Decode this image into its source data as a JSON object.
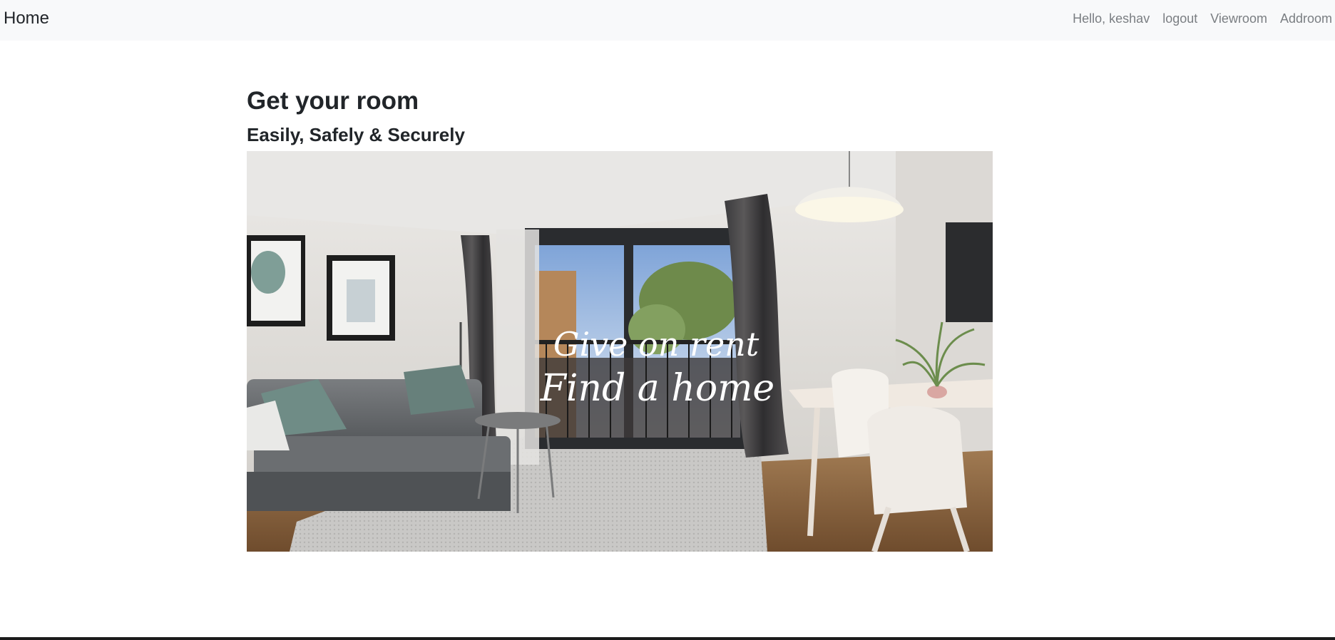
{
  "navbar": {
    "brand": "Home",
    "greeting": "Hello, keshav",
    "links": [
      "logout",
      "Viewroom",
      "Addroom"
    ]
  },
  "main": {
    "title": "Get your room",
    "subtitle": "Easily, Safely & Securely",
    "hero": {
      "line1": "Give on rent",
      "line2": "Find a home"
    }
  }
}
